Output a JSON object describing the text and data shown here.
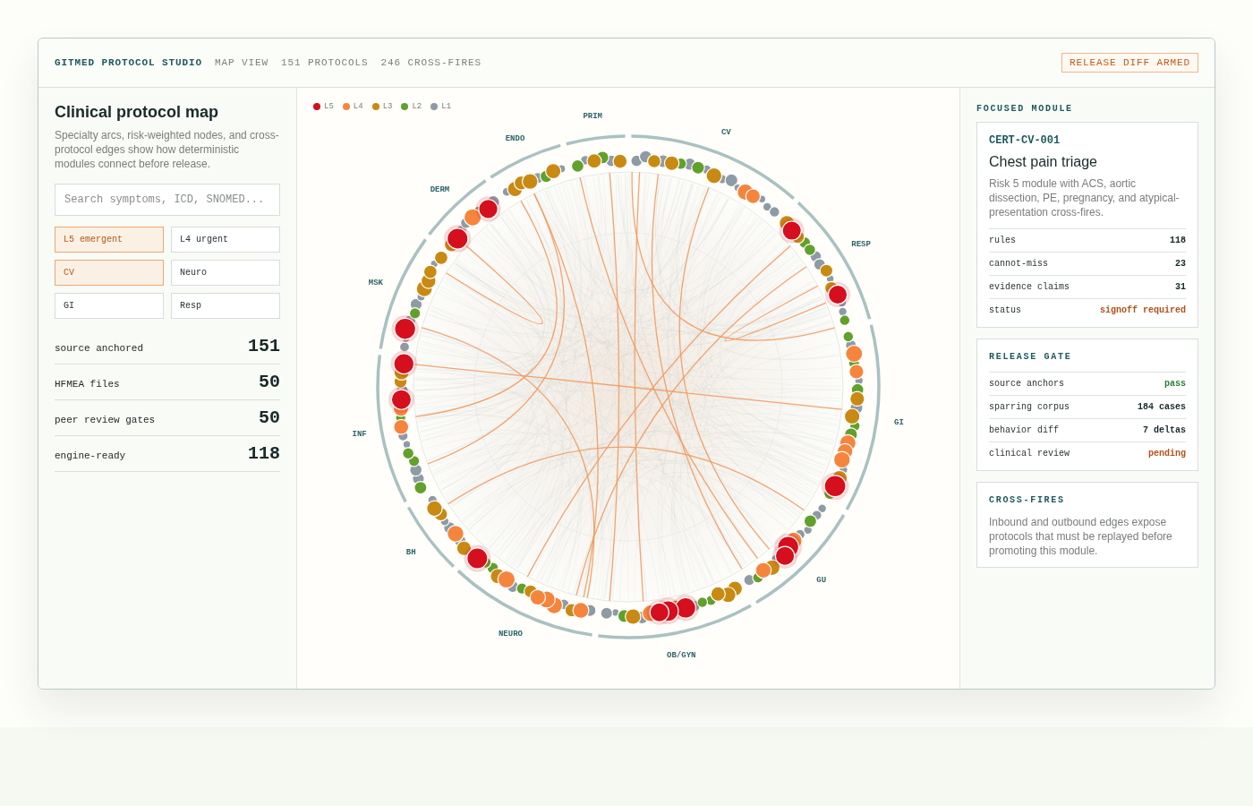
{
  "header": {
    "brand": "GITMED PROTOCOL STUDIO",
    "meta": [
      "MAP VIEW",
      "151 PROTOCOLS",
      "246 CROSS-FIRES"
    ],
    "badge": "RELEASE DIFF ARMED"
  },
  "sidebar": {
    "title": "Clinical protocol map",
    "description": "Specialty arcs, risk-weighted nodes, and cross-protocol edges show how deterministic modules connect before release.",
    "search": {
      "placeholder": "Search symptoms, ICD, SNOMED..."
    },
    "filters": [
      {
        "label": "L5 emergent",
        "selected": true
      },
      {
        "label": "L4 urgent",
        "selected": false
      },
      {
        "label": "CV",
        "selected": true
      },
      {
        "label": "Neuro",
        "selected": false
      },
      {
        "label": "GI",
        "selected": false
      },
      {
        "label": "Resp",
        "selected": false
      }
    ],
    "stats": [
      {
        "label": "source anchored",
        "value": "151"
      },
      {
        "label": "HFMEA files",
        "value": "50"
      },
      {
        "label": "peer review gates",
        "value": "50"
      },
      {
        "label": "engine-ready",
        "value": "118"
      }
    ]
  },
  "map": {
    "legend": [
      {
        "label": "L5",
        "color": "#d50f1e"
      },
      {
        "label": "L4",
        "color": "#f5853d"
      },
      {
        "label": "L3",
        "color": "#c98a13"
      },
      {
        "label": "L2",
        "color": "#62a02c"
      },
      {
        "label": "L1",
        "color": "#8f9ba4"
      }
    ],
    "specialties": [
      {
        "label": "PRIM"
      },
      {
        "label": "CV"
      },
      {
        "label": "RESP"
      },
      {
        "label": "GI"
      },
      {
        "label": "GU"
      },
      {
        "label": "OB/GYN"
      },
      {
        "label": "NEURO"
      },
      {
        "label": "BH"
      },
      {
        "label": "INF"
      },
      {
        "label": "MSK"
      },
      {
        "label": "DERM"
      },
      {
        "label": "ENDO"
      }
    ]
  },
  "focused_module": {
    "heading": "FOCUSED MODULE",
    "id": "CERT-CV-001",
    "title": "Chest pain triage",
    "description": "Risk 5 module with ACS, aortic dissection, PE, pregnancy, and atypical-presentation cross-fires.",
    "rows": [
      {
        "label": "rules",
        "value": "118",
        "kind": "plain"
      },
      {
        "label": "cannot-miss",
        "value": "23",
        "kind": "plain"
      },
      {
        "label": "evidence claims",
        "value": "31",
        "kind": "plain"
      },
      {
        "label": "status",
        "value": "signoff required",
        "kind": "warning"
      }
    ]
  },
  "release_gate": {
    "heading": "RELEASE GATE",
    "rows": [
      {
        "label": "source anchors",
        "value": "pass",
        "kind": "pass"
      },
      {
        "label": "sparring corpus",
        "value": "184 cases",
        "kind": "plain"
      },
      {
        "label": "behavior diff",
        "value": "7 deltas",
        "kind": "plain"
      },
      {
        "label": "clinical review",
        "value": "pending",
        "kind": "warning"
      }
    ]
  },
  "cross_fires": {
    "heading": "CROSS-FIRES",
    "description": "Inbound and outbound edges expose protocols that must be replayed before promoting this module."
  }
}
